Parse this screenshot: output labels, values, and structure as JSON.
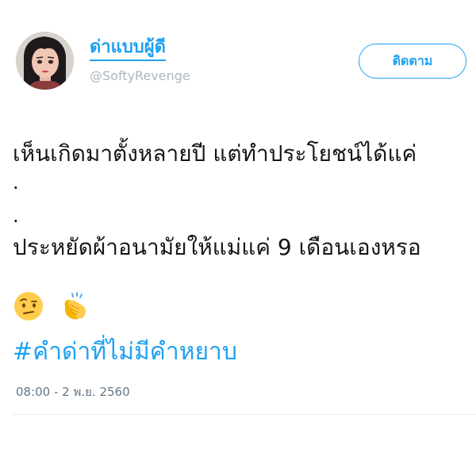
{
  "author": {
    "display_name": "ด่าแบบผู้ดี",
    "username": "@SoftyRevenge",
    "avatar_icon": "avatar-portrait-icon"
  },
  "follow_button": {
    "label": "ติดตาม"
  },
  "tweet": {
    "line1": "เห็นเกิดมาตั้งหลายปี แต่ทำประโยชน์ได้แค่",
    "line2": ".",
    "line3": ".",
    "line4": "ประหยัดผ้าอนามัยให้แม่แค่ 9 เดือนเองหรอ",
    "emojis": [
      "face-with-raised-eyebrow-icon",
      "clapping-hands-icon"
    ],
    "hashtag": "#คำด่าที่ไม่มีคำหยาบ",
    "timestamp": "08:00 - 2 พ.ย. 2560"
  },
  "colors": {
    "accent": "#1da1f2",
    "text": "#14171a",
    "muted": "#657786"
  }
}
